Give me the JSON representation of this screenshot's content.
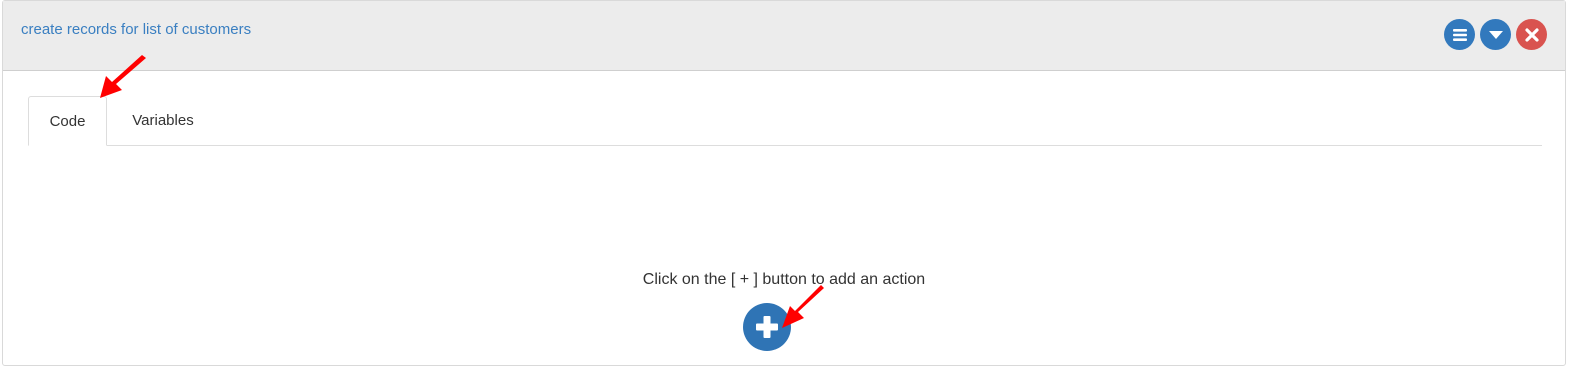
{
  "panel": {
    "title": "create records for list of customers",
    "header_buttons": [
      {
        "icon": "menu-icon",
        "color": "#3279bd"
      },
      {
        "icon": "chevron-down-icon",
        "color": "#3279bd"
      },
      {
        "icon": "close-icon",
        "color": "#d9534f"
      }
    ]
  },
  "tabs": [
    {
      "label": "Code",
      "active": true
    },
    {
      "label": "Variables",
      "active": false
    }
  ],
  "content": {
    "hint": "Click on the [ + ] button to add an action",
    "add_button_icon": "plus-icon",
    "add_button_color": "#2f74b5"
  },
  "annotations": {
    "arrow_color": "#ff0000"
  }
}
